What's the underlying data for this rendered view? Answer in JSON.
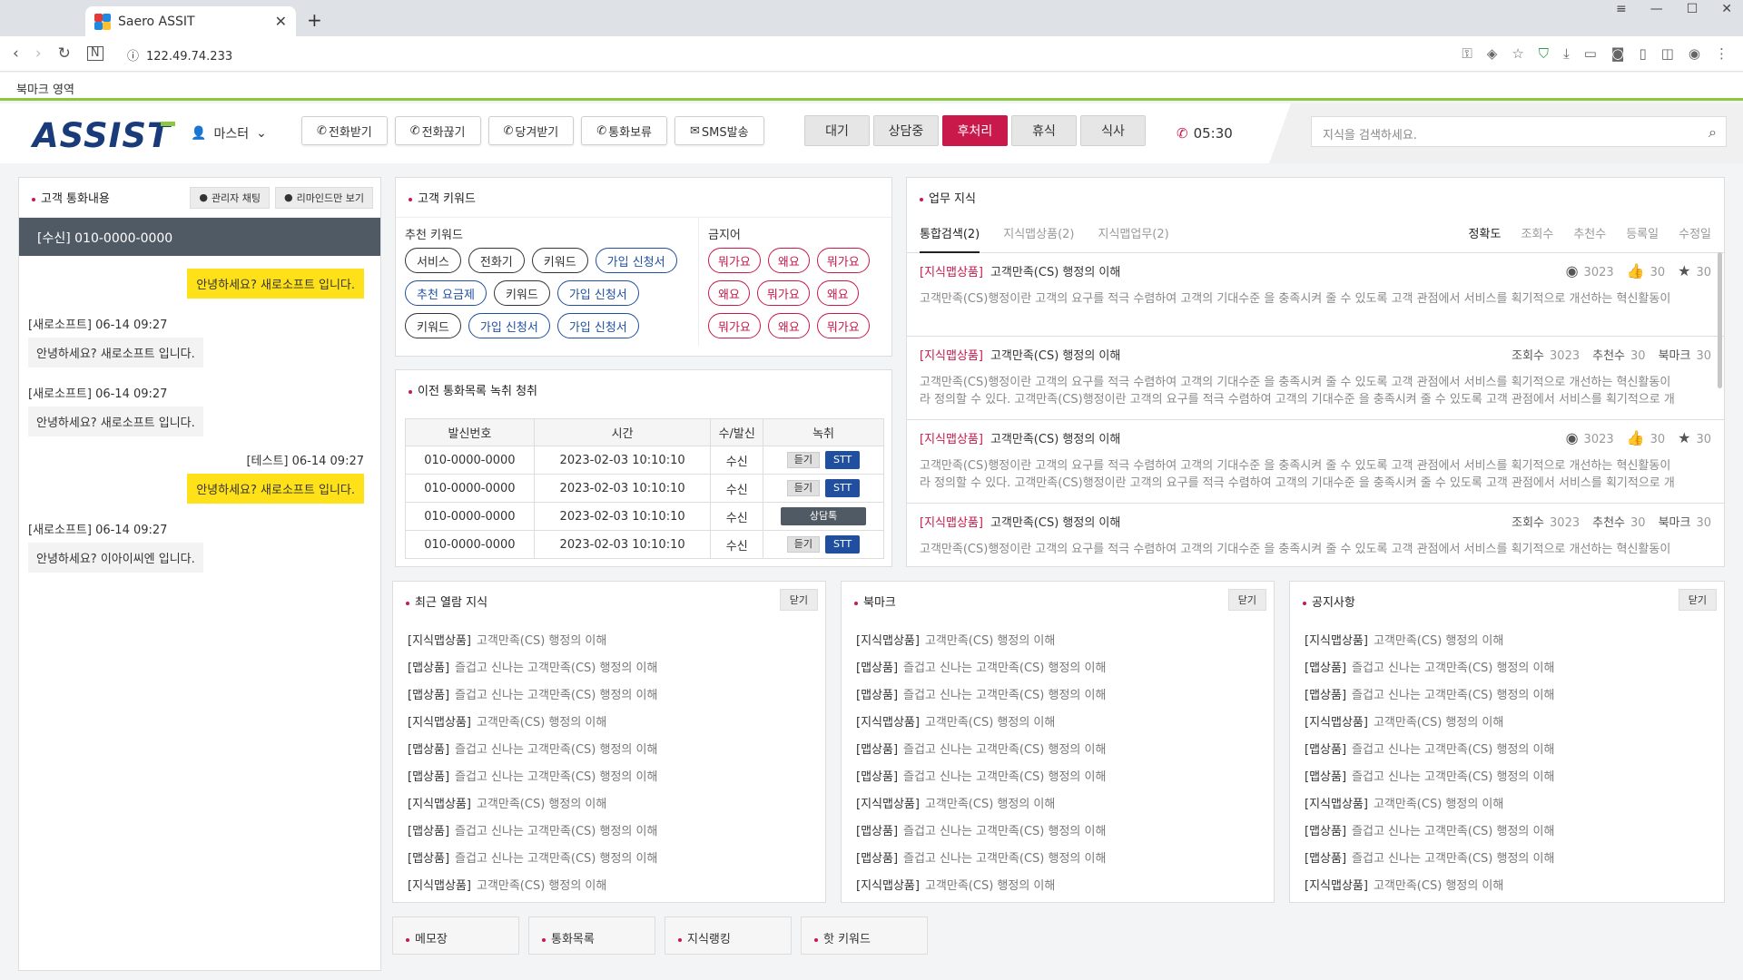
{
  "browser": {
    "tab_title": "Saero ASSIT",
    "url": "122.49.74.233",
    "bookmark_bar": "북마크 영역"
  },
  "header": {
    "logo": "ASSIST",
    "user": "마스터",
    "call_buttons": [
      "전화받기",
      "전화끊기",
      "당겨받기",
      "통화보류",
      "SMS발송"
    ],
    "status_buttons": [
      "대기",
      "상담중",
      "후처리",
      "휴식",
      "식사"
    ],
    "active_status": "후처리",
    "timer": "05:30",
    "search_placeholder": "지식을 검색하세요."
  },
  "chat": {
    "title": "고객 통화내용",
    "admin_chat": "관리자 채팅",
    "remind_only": "리마인드만 보기",
    "caller": "[수신] 010-0000-0000",
    "messages": [
      {
        "type": "agent",
        "text": "안녕하세요? 새로소프트 입니다."
      },
      {
        "type": "cust",
        "who": "[새로소프트] 06-14 09:27",
        "text": "안녕하세요? 새로소프트 입니다."
      },
      {
        "type": "cust",
        "who": "[새로소프트] 06-14 09:27",
        "text": "안녕하세요? 새로소프트 입니다."
      },
      {
        "type": "agent_named",
        "who": "[테스트] 06-14 09:27",
        "text": "안녕하세요? 새로소프트 입니다."
      },
      {
        "type": "cust",
        "who": "[새로소프트] 06-14 09:27",
        "text": "안녕하세요? 이아이씨엔 입니다."
      }
    ]
  },
  "keywords": {
    "title": "고객 키워드",
    "recommended_label": "추천 키워드",
    "recommended": [
      {
        "text": "서비스",
        "style": "dark"
      },
      {
        "text": "전화기",
        "style": "dark"
      },
      {
        "text": "키워드",
        "style": "dark"
      },
      {
        "text": "가입 신청서",
        "style": "blue"
      },
      {
        "text": "추천 요금제",
        "style": "blue"
      },
      {
        "text": "키워드",
        "style": "dark"
      },
      {
        "text": "가입 신청서",
        "style": "blue"
      },
      {
        "text": "키워드",
        "style": "dark"
      },
      {
        "text": "가입 신청서",
        "style": "blue"
      },
      {
        "text": "가입 신청서",
        "style": "blue"
      }
    ],
    "banned_label": "금지어",
    "banned": [
      "뭐가요",
      "왜요",
      "뭐가요",
      "왜요",
      "뭐가요",
      "왜요",
      "뭐가요",
      "왜요",
      "뭐가요"
    ]
  },
  "records": {
    "title": "이전 통화목록 녹취 청취",
    "headers": [
      "발신번호",
      "시간",
      "수/발신",
      "녹취"
    ],
    "listen_label": "듣기",
    "stt_label": "STT",
    "consult_label": "상담톡",
    "rows": [
      {
        "number": "010-0000-0000",
        "time": "2023-02-03 10:10:10",
        "dir": "수신",
        "kind": "listen"
      },
      {
        "number": "010-0000-0000",
        "time": "2023-02-03 10:10:10",
        "dir": "수신",
        "kind": "listen"
      },
      {
        "number": "010-0000-0000",
        "time": "2023-02-03 10:10:10",
        "dir": "수신",
        "kind": "consult"
      },
      {
        "number": "010-0000-0000",
        "time": "2023-02-03 10:10:10",
        "dir": "수신",
        "kind": "listen"
      }
    ]
  },
  "knowledge": {
    "title": "업무 지식",
    "tabs": [
      "통합검색(2)",
      "지식맵상품(2)",
      "지식맵업무(2)"
    ],
    "sorts": [
      "정확도",
      "조회수",
      "추천수",
      "등록일",
      "수정일"
    ],
    "items": [
      {
        "tag": "[지식맵상품]",
        "title": "고객만족(CS) 행정의 이해",
        "meta": "icons",
        "views": "3023",
        "likes": "30",
        "stars": "30",
        "body1": "고객만족(CS)행정이란 고객의 요구를 적극 수렴하여 고객의 기대수준 을 충족시켜 줄 수 있도록 고객 관점에서 서비스를 획기적으로 개선하는 혁신활동이",
        "body2": ""
      },
      {
        "tag": "[지식맵상품]",
        "title": "고객만족(CS) 행정의 이해",
        "meta": "text",
        "views_label": "조회수",
        "views": "3023",
        "likes_label": "추천수",
        "likes": "30",
        "stars_label": "북마크",
        "stars": "30",
        "body1": "고객만족(CS)행정이란 고객의 요구를 적극 수렴하여 고객의 기대수준 을 충족시켜 줄 수 있도록 고객 관점에서 서비스를 획기적으로 개선하는 혁신활동이",
        "body2": "라 정의할 수 있다. 고객만족(CS)행정이란 고객의 요구를 적극 수렴하여 고객의 기대수준 을 충족시켜 줄 수 있도록 고객 관점에서 서비스를 획기적으로 개"
      },
      {
        "tag": "[지식맵상품]",
        "title": "고객만족(CS) 행정의 이해",
        "meta": "icons",
        "views": "3023",
        "likes": "30",
        "stars": "30",
        "body1": "고객만족(CS)행정이란 고객의 요구를 적극 수렴하여 고객의 기대수준 을 충족시켜 줄 수 있도록 고객 관점에서 서비스를 획기적으로 개선하는 혁신활동이",
        "body2": "라 정의할 수 있다. 고객만족(CS)행정이란 고객의 요구를 적극 수렴하여 고객의 기대수준 을 충족시켜 줄 수 있도록 고객 관점에서 서비스를 획기적으로 개"
      },
      {
        "tag": "[지식맵상품]",
        "title": "고객만족(CS) 행정의 이해",
        "meta": "text",
        "views_label": "조회수",
        "views": "3023",
        "likes_label": "추천수",
        "likes": "30",
        "stars_label": "북마크",
        "stars": "30",
        "body1": "고객만족(CS)행정이란 고객의 요구를 적극 수렴하여 고객의 기대수준 을 충족시켜 줄 수 있도록 고객 관점에서 서비스를 획기적으로 개선하는 혁신활동이",
        "body2": ""
      }
    ]
  },
  "close_label": "닫기",
  "lists": [
    {
      "title": "최근 열람 지식",
      "key": "recent"
    },
    {
      "title": "북마크",
      "key": "bookmark"
    },
    {
      "title": "공지사항",
      "key": "notice"
    }
  ],
  "list_items": [
    {
      "t": "[지식맵상품]",
      "d": "고객만족(CS) 행정의 이해"
    },
    {
      "t": "[맵상품]",
      "d": "즐겁고 신나는 고객만족(CS) 행정의 이해"
    },
    {
      "t": "[맵상품]",
      "d": "즐겁고 신나는 고객만족(CS) 행정의 이해"
    },
    {
      "t": "[지식맵상품]",
      "d": "고객만족(CS) 행정의 이해"
    },
    {
      "t": "[맵상품]",
      "d": "즐겁고 신나는 고객만족(CS) 행정의 이해"
    },
    {
      "t": "[맵상품]",
      "d": "즐겁고 신나는 고객만족(CS) 행정의 이해"
    },
    {
      "t": "[지식맵상품]",
      "d": "고객만족(CS) 행정의 이해"
    },
    {
      "t": "[맵상품]",
      "d": "즐겁고 신나는 고객만족(CS) 행정의 이해"
    },
    {
      "t": "[맵상품]",
      "d": "즐겁고 신나는 고객만족(CS) 행정의 이해"
    },
    {
      "t": "[지식맵상품]",
      "d": "고객만족(CS) 행정의 이해"
    }
  ],
  "bottom_tabs": [
    "메모장",
    "통화목록",
    "지식랭킹",
    "핫 키워드"
  ],
  "colors": {
    "accent": "#c8194a",
    "navy": "#1f4f9e",
    "green": "#8dc63f",
    "chat_yellow": "#ffe11a"
  }
}
